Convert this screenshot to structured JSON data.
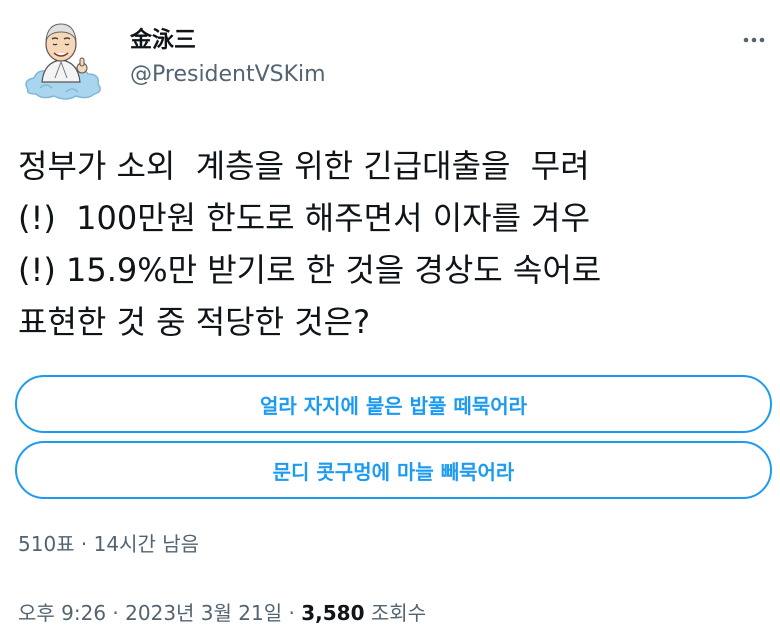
{
  "author": {
    "name": "金泳三",
    "handle": "@PresidentVSKim",
    "avatar": "cartoon-portrait-on-cloud"
  },
  "tweet": {
    "lines": [
      "정부가 소외  계층을 위한 긴급대출을  무려",
      "(!)  100만원 한도로 해주면서 이자를 겨우",
      "(!) 15.9%만 받기로 한 것을 경상도 속어로",
      "표현한 것 중 적당한 것은?"
    ]
  },
  "poll": {
    "options": [
      "얼라 자지에 붙은 밥풀 떼묵어라",
      "문디 콧구멍에 마늘 빼묵어라"
    ],
    "votes": "510표",
    "separator": " · ",
    "time_left": "14시간 남음"
  },
  "meta": {
    "time": "오후 9:26",
    "date": "2023년 3월 21일",
    "views_count": "3,580",
    "views_label": "조회수",
    "separator": " · "
  },
  "icons": {
    "more": "more-horizontal-icon"
  },
  "colors": {
    "accent": "#1d9bf0",
    "secondary_text": "#536471",
    "primary_text": "#0f1419"
  }
}
